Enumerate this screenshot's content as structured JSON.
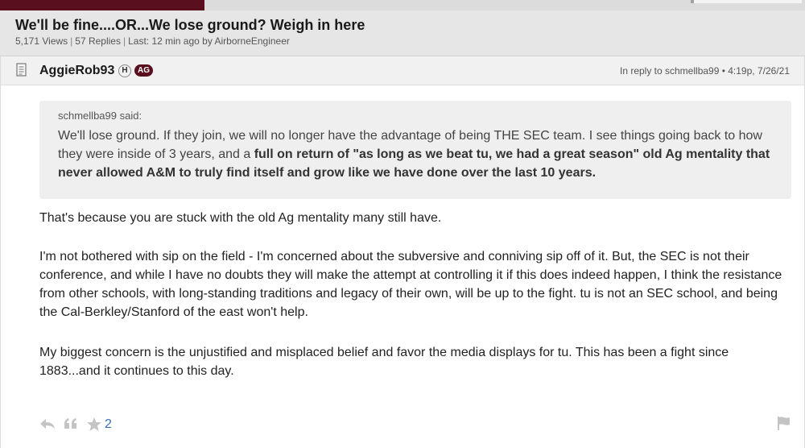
{
  "thread": {
    "title": "We'll be fine....OR...We lose ground? Weigh in here",
    "views": "5,171 Views",
    "replies": "57 Replies",
    "last": "Last: 12 min ago by AirborneEngineer",
    "separator": "|"
  },
  "post": {
    "author": "AggieRob93",
    "badge_h": "H",
    "badge_ag": "AG",
    "reply_info": "In reply to schmellba99 • 4:19p, 7/26/21",
    "quote": {
      "author": "schmellba99 said:",
      "text_plain": "We'll lose ground. If they join, we will no longer have the advantage of being THE SEC team. I see things going back to how they were inside of 3 years, and a ",
      "text_bold": "full on return of \"as long as we beat tu, we had a great season\" old Ag mentality that never allowed A&M to truly find itself and grow like we have done over the last 10 years."
    },
    "paragraphs": [
      "That's because you are stuck with the old Ag mentality many still have.",
      "I'm not bothered with sip on the field - I'm concerned about the subversive and conniving sip off of it. But, the SEC is not their conference, and while I have no doubts they will make the attempt at controlling it if this does indeed happen, I think the resistance from other schools, with long-standing traditions and legacy of their own, will be up to the fight. tu is not an SEC school, and being the Cal-Berkley/Stanford of the east won't help.",
      "My biggest concern is the unjustified and misplaced belief and favor the media displays for tu. This has been a fight since 1883...and it continues to this day."
    ],
    "star_count": "2"
  },
  "icons": {
    "post": "document-icon",
    "reply": "reply-arrow-icon",
    "quote": "quote-icon",
    "star": "star-icon",
    "flag": "flag-icon"
  },
  "colors": {
    "brand": "#5a0f1e",
    "link": "#3a6fb0",
    "header_bg": "#e6e6e6",
    "quote_bg": "#efefef"
  }
}
